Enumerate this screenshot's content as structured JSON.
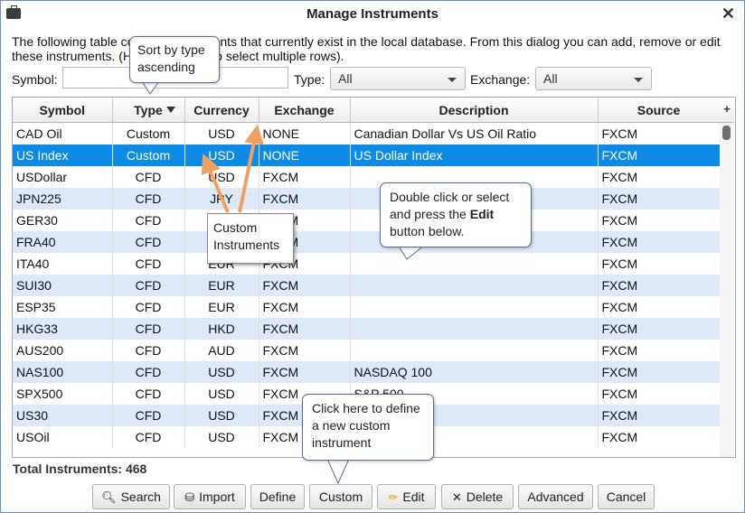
{
  "window": {
    "title": "Manage Instruments",
    "close_glyph": "✕"
  },
  "intro_text": "The following table contains instruments that currently exist in the local database.  From this dialog you can add, remove or edit these instruments. (Hold CTRL key to select multiple rows).",
  "filters": {
    "symbol_label": "Symbol:",
    "symbol_value": "",
    "type_label": "Type:",
    "type_value": "All",
    "exchange_label": "Exchange:",
    "exchange_value": "All"
  },
  "table": {
    "columns": [
      "Symbol",
      "Type",
      "Currency",
      "Exchange",
      "Description",
      "Source"
    ],
    "plus_glyph": "+",
    "rows": [
      [
        "CAD Oil",
        "Custom",
        "USD",
        "NONE",
        "Canadian Dollar Vs US Oil Ratio",
        "FXCM"
      ],
      [
        "US Index",
        "Custom",
        "USD",
        "NONE",
        "US Dollar Index",
        "FXCM"
      ],
      [
        "USDollar",
        "CFD",
        "USD",
        "FXCM",
        "",
        "FXCM"
      ],
      [
        "JPN225",
        "CFD",
        "JPY",
        "FXCM",
        "",
        "FXCM"
      ],
      [
        "GER30",
        "CFD",
        "EUR",
        "FXCM",
        "",
        "FXCM"
      ],
      [
        "FRA40",
        "CFD",
        "EUR",
        "FXCM",
        "",
        "FXCM"
      ],
      [
        "ITA40",
        "CFD",
        "EUR",
        "FXCM",
        "",
        "FXCM"
      ],
      [
        "SUI30",
        "CFD",
        "EUR",
        "FXCM",
        "",
        "FXCM"
      ],
      [
        "ESP35",
        "CFD",
        "EUR",
        "FXCM",
        "",
        "FXCM"
      ],
      [
        "HKG33",
        "CFD",
        "HKD",
        "FXCM",
        "",
        "FXCM"
      ],
      [
        "AUS200",
        "CFD",
        "AUD",
        "FXCM",
        "",
        "FXCM"
      ],
      [
        "NAS100",
        "CFD",
        "USD",
        "FXCM",
        "NASDAQ 100",
        "FXCM"
      ],
      [
        "SPX500",
        "CFD",
        "USD",
        "FXCM",
        "S&P 500",
        "FXCM"
      ],
      [
        "US30",
        "CFD",
        "USD",
        "FXCM",
        "",
        "FXCM"
      ],
      [
        "USOil",
        "CFD",
        "USD",
        "FXCM",
        "",
        "FXCM"
      ]
    ],
    "selected_row": 1
  },
  "total_label": "Total Instruments: 468",
  "buttons": {
    "search": "Search",
    "import": "Import",
    "define": "Define",
    "custom": "Custom",
    "edit": "Edit",
    "delete": "Delete",
    "advanced": "Advanced",
    "cancel": "Cancel"
  },
  "callouts": {
    "sort": "Sort by type ascending",
    "custom_instruments": "Custom Instruments",
    "double_click_1": "Double click or select and press the ",
    "double_click_bold": "Edit",
    "double_click_2": " button below.",
    "click_here": "Click here to define a new custom instrument"
  },
  "colors": {
    "selected_row": "#0d8be6",
    "alt_row": "#dde9f7",
    "arrow": "#f0a060"
  }
}
